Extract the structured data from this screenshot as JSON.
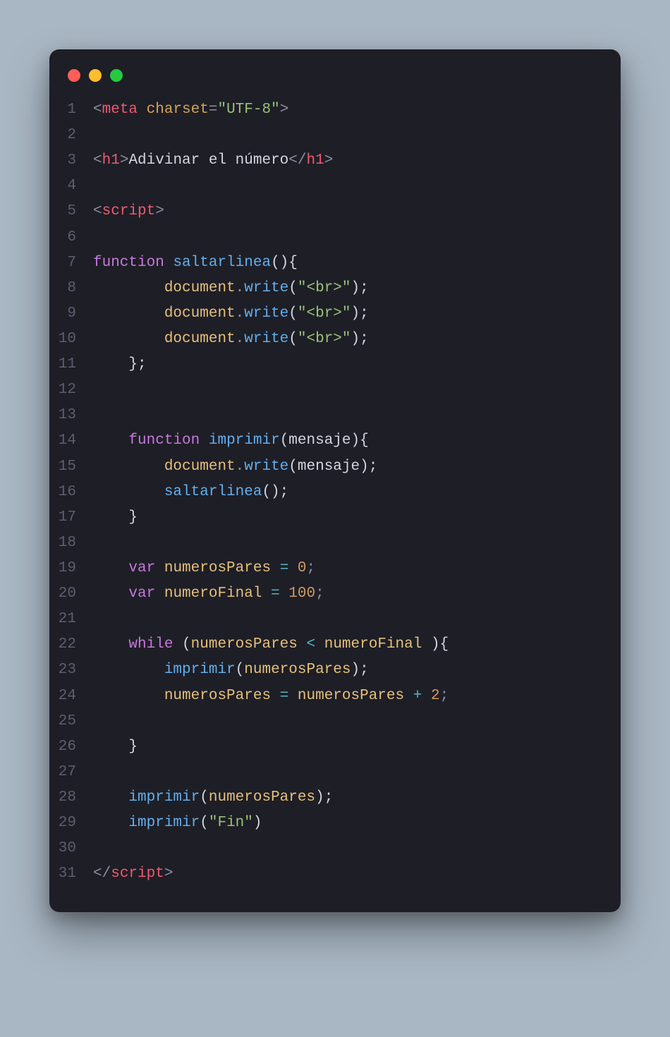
{
  "window": {
    "traffic": {
      "red": "#ff5f56",
      "yellow": "#ffbd2e",
      "green": "#27c93f"
    }
  },
  "code": {
    "lines": [
      {
        "n": "1",
        "tokens": [
          {
            "t": "<",
            "c": "punct"
          },
          {
            "t": "meta",
            "c": "tag-name"
          },
          {
            "t": " ",
            "c": "text"
          },
          {
            "t": "charset",
            "c": "attr-name"
          },
          {
            "t": "=",
            "c": "punct"
          },
          {
            "t": "\"UTF-8\"",
            "c": "string"
          },
          {
            "t": ">",
            "c": "punct"
          }
        ]
      },
      {
        "n": "2",
        "tokens": []
      },
      {
        "n": "3",
        "tokens": [
          {
            "t": "<",
            "c": "punct"
          },
          {
            "t": "h1",
            "c": "tag-name"
          },
          {
            "t": ">",
            "c": "punct"
          },
          {
            "t": "Adivinar el número",
            "c": "text"
          },
          {
            "t": "</",
            "c": "punct"
          },
          {
            "t": "h1",
            "c": "tag-name"
          },
          {
            "t": ">",
            "c": "punct"
          }
        ]
      },
      {
        "n": "4",
        "tokens": []
      },
      {
        "n": "5",
        "tokens": [
          {
            "t": "<",
            "c": "punct"
          },
          {
            "t": "script",
            "c": "tag-name"
          },
          {
            "t": ">",
            "c": "punct"
          }
        ]
      },
      {
        "n": "6",
        "tokens": []
      },
      {
        "n": "7",
        "tokens": [
          {
            "t": "function",
            "c": "keyword"
          },
          {
            "t": " ",
            "c": "text"
          },
          {
            "t": "saltarlinea",
            "c": "fn-name"
          },
          {
            "t": "(){",
            "c": "brace"
          }
        ]
      },
      {
        "n": "8",
        "tokens": [
          {
            "t": "        ",
            "c": "text"
          },
          {
            "t": "document",
            "c": "ident"
          },
          {
            "t": ".",
            "c": "punct"
          },
          {
            "t": "write",
            "c": "fn-name"
          },
          {
            "t": "(",
            "c": "brace"
          },
          {
            "t": "\"<br>\"",
            "c": "string"
          },
          {
            "t": ");",
            "c": "brace"
          }
        ]
      },
      {
        "n": "9",
        "tokens": [
          {
            "t": "        ",
            "c": "text"
          },
          {
            "t": "document",
            "c": "ident"
          },
          {
            "t": ".",
            "c": "punct"
          },
          {
            "t": "write",
            "c": "fn-name"
          },
          {
            "t": "(",
            "c": "brace"
          },
          {
            "t": "\"<br>\"",
            "c": "string"
          },
          {
            "t": ");",
            "c": "brace"
          }
        ]
      },
      {
        "n": "10",
        "tokens": [
          {
            "t": "        ",
            "c": "text"
          },
          {
            "t": "document",
            "c": "ident"
          },
          {
            "t": ".",
            "c": "punct"
          },
          {
            "t": "write",
            "c": "fn-name"
          },
          {
            "t": "(",
            "c": "brace"
          },
          {
            "t": "\"<br>\"",
            "c": "string"
          },
          {
            "t": ");",
            "c": "brace"
          }
        ]
      },
      {
        "n": "11",
        "tokens": [
          {
            "t": "    };",
            "c": "brace"
          }
        ]
      },
      {
        "n": "12",
        "tokens": []
      },
      {
        "n": "13",
        "tokens": []
      },
      {
        "n": "14",
        "tokens": [
          {
            "t": "    ",
            "c": "text"
          },
          {
            "t": "function",
            "c": "keyword"
          },
          {
            "t": " ",
            "c": "text"
          },
          {
            "t": "imprimir",
            "c": "fn-name"
          },
          {
            "t": "(",
            "c": "brace"
          },
          {
            "t": "mensaje",
            "c": "param"
          },
          {
            "t": "){",
            "c": "brace"
          }
        ]
      },
      {
        "n": "15",
        "tokens": [
          {
            "t": "        ",
            "c": "text"
          },
          {
            "t": "document",
            "c": "ident"
          },
          {
            "t": ".",
            "c": "punct"
          },
          {
            "t": "write",
            "c": "fn-name"
          },
          {
            "t": "(",
            "c": "brace"
          },
          {
            "t": "mensaje",
            "c": "param"
          },
          {
            "t": ");",
            "c": "brace"
          }
        ]
      },
      {
        "n": "16",
        "tokens": [
          {
            "t": "        ",
            "c": "text"
          },
          {
            "t": "saltarlinea",
            "c": "fn-name"
          },
          {
            "t": "();",
            "c": "brace"
          }
        ]
      },
      {
        "n": "17",
        "tokens": [
          {
            "t": "    }",
            "c": "brace"
          }
        ]
      },
      {
        "n": "18",
        "tokens": []
      },
      {
        "n": "19",
        "tokens": [
          {
            "t": "    ",
            "c": "text"
          },
          {
            "t": "var",
            "c": "keyword"
          },
          {
            "t": " ",
            "c": "text"
          },
          {
            "t": "numerosPares",
            "c": "ident"
          },
          {
            "t": " ",
            "c": "text"
          },
          {
            "t": "=",
            "c": "op"
          },
          {
            "t": " ",
            "c": "text"
          },
          {
            "t": "0",
            "c": "num"
          },
          {
            "t": ";",
            "c": "punct"
          }
        ]
      },
      {
        "n": "20",
        "tokens": [
          {
            "t": "    ",
            "c": "text"
          },
          {
            "t": "var",
            "c": "keyword"
          },
          {
            "t": " ",
            "c": "text"
          },
          {
            "t": "numeroFinal",
            "c": "ident"
          },
          {
            "t": " ",
            "c": "text"
          },
          {
            "t": "=",
            "c": "op"
          },
          {
            "t": " ",
            "c": "text"
          },
          {
            "t": "100",
            "c": "num"
          },
          {
            "t": ";",
            "c": "punct"
          }
        ]
      },
      {
        "n": "21",
        "tokens": []
      },
      {
        "n": "22",
        "tokens": [
          {
            "t": "    ",
            "c": "text"
          },
          {
            "t": "while",
            "c": "keyword"
          },
          {
            "t": " (",
            "c": "brace"
          },
          {
            "t": "numerosPares",
            "c": "ident"
          },
          {
            "t": " ",
            "c": "text"
          },
          {
            "t": "<",
            "c": "op"
          },
          {
            "t": " ",
            "c": "text"
          },
          {
            "t": "numeroFinal",
            "c": "ident"
          },
          {
            "t": " ){",
            "c": "brace"
          }
        ]
      },
      {
        "n": "23",
        "tokens": [
          {
            "t": "        ",
            "c": "text"
          },
          {
            "t": "imprimir",
            "c": "fn-name"
          },
          {
            "t": "(",
            "c": "brace"
          },
          {
            "t": "numerosPares",
            "c": "ident"
          },
          {
            "t": ");",
            "c": "brace"
          }
        ]
      },
      {
        "n": "24",
        "tokens": [
          {
            "t": "        ",
            "c": "text"
          },
          {
            "t": "numerosPares",
            "c": "ident"
          },
          {
            "t": " ",
            "c": "text"
          },
          {
            "t": "=",
            "c": "op"
          },
          {
            "t": " ",
            "c": "text"
          },
          {
            "t": "numerosPares",
            "c": "ident"
          },
          {
            "t": " ",
            "c": "text"
          },
          {
            "t": "+",
            "c": "op"
          },
          {
            "t": " ",
            "c": "text"
          },
          {
            "t": "2",
            "c": "num"
          },
          {
            "t": ";",
            "c": "punct"
          }
        ]
      },
      {
        "n": "25",
        "tokens": []
      },
      {
        "n": "26",
        "tokens": [
          {
            "t": "    }",
            "c": "brace"
          }
        ]
      },
      {
        "n": "27",
        "tokens": []
      },
      {
        "n": "28",
        "tokens": [
          {
            "t": "    ",
            "c": "text"
          },
          {
            "t": "imprimir",
            "c": "fn-name"
          },
          {
            "t": "(",
            "c": "brace"
          },
          {
            "t": "numerosPares",
            "c": "ident"
          },
          {
            "t": ");",
            "c": "brace"
          }
        ]
      },
      {
        "n": "29",
        "tokens": [
          {
            "t": "    ",
            "c": "text"
          },
          {
            "t": "imprimir",
            "c": "fn-name"
          },
          {
            "t": "(",
            "c": "brace"
          },
          {
            "t": "\"Fin\"",
            "c": "string"
          },
          {
            "t": ")",
            "c": "brace"
          }
        ]
      },
      {
        "n": "30",
        "tokens": []
      },
      {
        "n": "31",
        "tokens": [
          {
            "t": "</",
            "c": "punct"
          },
          {
            "t": "script",
            "c": "tag-name"
          },
          {
            "t": ">",
            "c": "punct"
          }
        ]
      }
    ]
  }
}
